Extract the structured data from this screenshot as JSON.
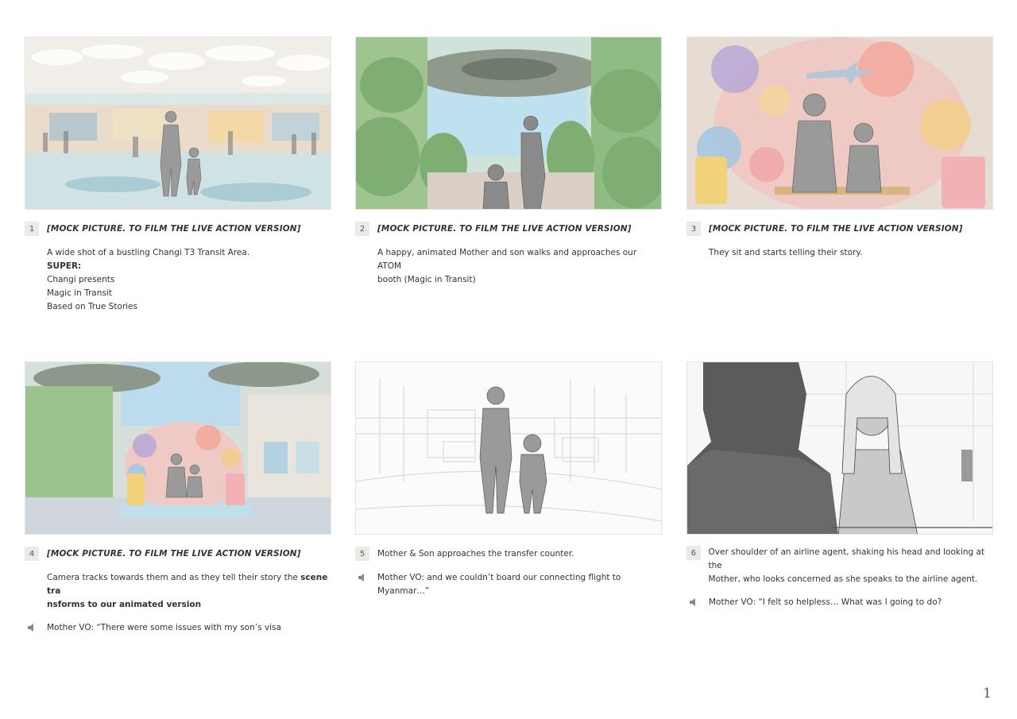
{
  "page_number": "1",
  "icons": {
    "audio": "speaker-icon"
  },
  "panels": [
    {
      "number": "1",
      "note": "[MOCK PICTURE. TO FILM THE LIVE ACTION VERSION]",
      "description": "A wide shot of a bustling Changi T3 Transit Area.",
      "super_label": "SUPER:",
      "super_lines": [
        "Changi presents",
        "Magic in Transit",
        "Based on True Stories"
      ]
    },
    {
      "number": "2",
      "note": "[MOCK PICTURE. TO FILM THE LIVE ACTION VERSION]",
      "description_line1": "A happy, animated Mother and son walks and approaches our ATOM",
      "description_line2": "booth (Magic in Transit)"
    },
    {
      "number": "3",
      "note": "[MOCK PICTURE. TO FILM THE LIVE ACTION VERSION]",
      "description": "They sit and starts telling their story."
    },
    {
      "number": "4",
      "note": "[MOCK PICTURE. TO FILM THE LIVE ACTION VERSION]",
      "description_part1": "Camera tracks towards them and as they tell their story the ",
      "description_bold1": "scene tra",
      "description_bold2": "nsforms to our animated version",
      "audio": "Mother VO: “There were some issues with my son’s visa"
    },
    {
      "number": "5",
      "description": "Mother & Son approaches the transfer counter.",
      "audio_line1": "Mother VO: and we couldn’t board our connecting flight to",
      "audio_line2": "Myanmar…”"
    },
    {
      "number": "6",
      "description_line1": "Over shoulder of an airline agent, shaking his head and looking at the",
      "description_line2": "Mother, who looks concerned as she speaks to the airline agent.",
      "audio": "Mother VO: “I felt so helpless… What was I going to do?"
    }
  ]
}
